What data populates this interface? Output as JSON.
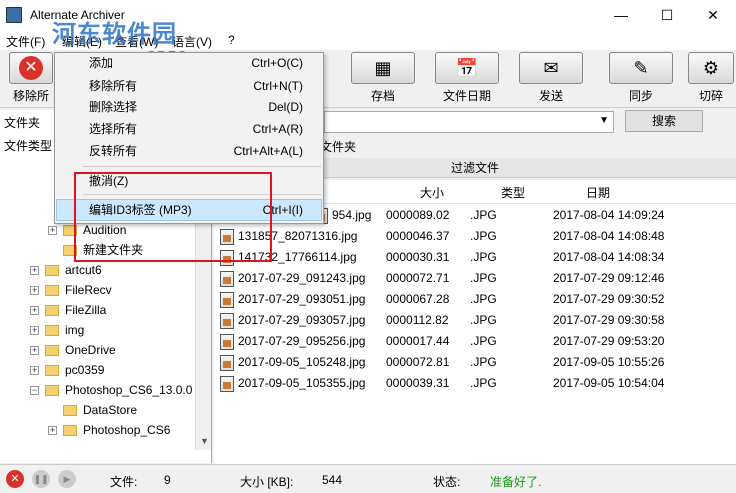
{
  "window": {
    "title": "Alternate Archiver",
    "min": "—",
    "max": "☐",
    "close": "✕"
  },
  "watermark": {
    "line1": "河东软件园",
    "line2": "www.pc0359.cn"
  },
  "menubar": [
    "文件(F)",
    "编辑(E)",
    "查看(W)",
    "语言(V)",
    "?"
  ],
  "toolbar": {
    "remove": "移除所",
    "archive": "存档",
    "filedate": "文件日期",
    "send": "发送",
    "sync": "同步",
    "cut": "切碎"
  },
  "left": {
    "folder_label": "文件夹",
    "filetype_label": "文件类型",
    "tree": [
      {
        "indent": 2,
        "label": "Audition",
        "expand": "+"
      },
      {
        "indent": 2,
        "label": "新建文件夹",
        "expand": ""
      },
      {
        "indent": 1,
        "label": "artcut6",
        "expand": "+"
      },
      {
        "indent": 1,
        "label": "FileRecv",
        "expand": "+"
      },
      {
        "indent": 1,
        "label": "FileZilla",
        "expand": "+"
      },
      {
        "indent": 1,
        "label": "img",
        "expand": "+"
      },
      {
        "indent": 1,
        "label": "OneDrive",
        "expand": "+"
      },
      {
        "indent": 1,
        "label": "pc0359",
        "expand": "+"
      },
      {
        "indent": 1,
        "label": "Photoshop_CS6_13.0.0",
        "expand": "−"
      },
      {
        "indent": 2,
        "label": "DataStore",
        "expand": ""
      },
      {
        "indent": 2,
        "label": "Photoshop_CS6",
        "expand": "+"
      }
    ]
  },
  "search": {
    "button": "搜索",
    "sub_label": "文件夹"
  },
  "files": {
    "filter_header": "过滤文件",
    "columns": {
      "size": "大小",
      "type": "类型",
      "date": "日期"
    },
    "rows": [
      {
        "name": "954.jpg",
        "size": "0000089.02",
        "type": ".JPG",
        "date": "2017-08-04 14:09:24"
      },
      {
        "name": "131857_82071316.jpg",
        "size": "0000046.37",
        "type": ".JPG",
        "date": "2017-08-04 14:08:48"
      },
      {
        "name": "141732_17766114.jpg",
        "size": "0000030.31",
        "type": ".JPG",
        "date": "2017-08-04 14:08:34"
      },
      {
        "name": "2017-07-29_091243.jpg",
        "size": "0000072.71",
        "type": ".JPG",
        "date": "2017-07-29 09:12:46"
      },
      {
        "name": "2017-07-29_093051.jpg",
        "size": "0000067.28",
        "type": ".JPG",
        "date": "2017-07-29 09:30:52"
      },
      {
        "name": "2017-07-29_093057.jpg",
        "size": "0000112.82",
        "type": ".JPG",
        "date": "2017-07-29 09:30:58"
      },
      {
        "name": "2017-07-29_095256.jpg",
        "size": "0000017.44",
        "type": ".JPG",
        "date": "2017-07-29 09:53:20"
      },
      {
        "name": "2017-09-05_105248.jpg",
        "size": "0000072.81",
        "type": ".JPG",
        "date": "2017-09-05 10:55:26"
      },
      {
        "name": "2017-09-05_105355.jpg",
        "size": "0000039.31",
        "type": ".JPG",
        "date": "2017-09-05 10:54:04"
      }
    ]
  },
  "context_menu": [
    {
      "label": "添加",
      "shortcut": "Ctrl+O(C)"
    },
    {
      "label": "移除所有",
      "shortcut": "Ctrl+N(T)"
    },
    {
      "label": "删除选择",
      "shortcut": "Del(D)"
    },
    {
      "label": "选择所有",
      "shortcut": "Ctrl+A(R)"
    },
    {
      "label": "反转所有",
      "shortcut": "Ctrl+Alt+A(L)"
    },
    {
      "label": "撤消(Z)",
      "shortcut": ""
    },
    {
      "label": "编辑ID3标签 (MP3)",
      "shortcut": "Ctrl+I(I)"
    }
  ],
  "status": {
    "files_label": "文件:",
    "files_value": "9",
    "size_label": "大小 [KB]:",
    "size_value": "544",
    "state_label": "状态:",
    "state_value": "准备好了.",
    "state_color": "#1a9a1a"
  },
  "colors": {
    "accent_red": "#e0141e",
    "highlight": "#cce8ff"
  }
}
